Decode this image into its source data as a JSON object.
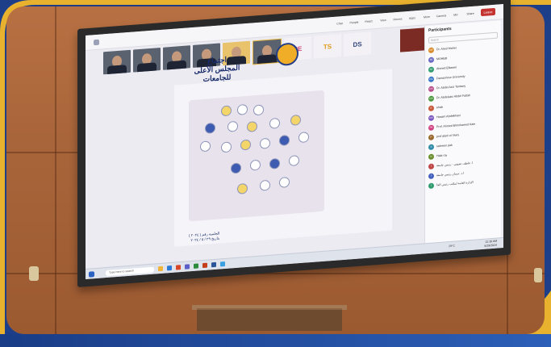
{
  "screen": {
    "topbar_buttons": [
      "Chat",
      "People",
      "React",
      "View",
      "Rooms",
      "Apps",
      "More",
      "Camera",
      "Mic",
      "Share"
    ],
    "leave_label": "Leave",
    "thumb_initials": [
      "PE",
      "TS",
      "DS"
    ],
    "slide": {
      "title_line1": "اجتماع",
      "title_line2": "المجلس الأعلى للجامعات",
      "date_line1": "الجلسة رقم ( ٢٠٢٤ )",
      "date_line2": "بتاريخ ٢٩ / ٥ / ٢٠٢٤"
    },
    "participants": {
      "title": "Participants",
      "search_placeholder": "Search",
      "rows": [
        {
          "initials": "DR",
          "name": "Dr. Ahed Maher",
          "color": "#d98b2b"
        },
        {
          "initials": "MI",
          "name": "MOHEB",
          "color": "#6a6ac2"
        },
        {
          "initials": "AE",
          "name": "Ahmed Elkaseri",
          "color": "#2f9b6e"
        },
        {
          "initials": "DU",
          "name": "Damanhour University",
          "color": "#3a77c9"
        },
        {
          "initials": "DA",
          "name": "Dr. Abdel Aziz Tantawy",
          "color": "#b84f8c"
        },
        {
          "initials": "DA",
          "name": "Dr. Abdelaziz Abdel Fattah",
          "color": "#4e9a3d"
        },
        {
          "initials": "E",
          "name": "ehab",
          "color": "#c9583a"
        },
        {
          "initials": "NA",
          "name": "Hesam Abdelkhani",
          "color": "#7b58c0"
        },
        {
          "initials": "PA",
          "name": "Prof. Ahmed Elmohamed Kaie",
          "color": "#d03f7e"
        },
        {
          "initials": "P",
          "name": "prof alam el hiwry",
          "color": "#9a6a2e"
        },
        {
          "initials": "S",
          "name": "sabreen pak",
          "color": "#2f8ba8"
        },
        {
          "initials": "N",
          "name": "Hala ray",
          "color": "#6b8f2f"
        },
        {
          "initials": "أ",
          "name": "أ. عاطف عفيفي - رئيس جامعة",
          "color": "#c04545"
        },
        {
          "initials": "أ",
          "name": "أ.د. حسان رئيس جامعة",
          "color": "#4561c0"
        },
        {
          "initials": "أ",
          "name": "الإدارة العامة لمكتب رئيس الجا",
          "color": "#2f9b6e"
        }
      ]
    },
    "taskbar": {
      "search_label": "Type here to search",
      "time": "11:16 AM",
      "date": "5/29/2024",
      "weather": "29°C"
    }
  }
}
